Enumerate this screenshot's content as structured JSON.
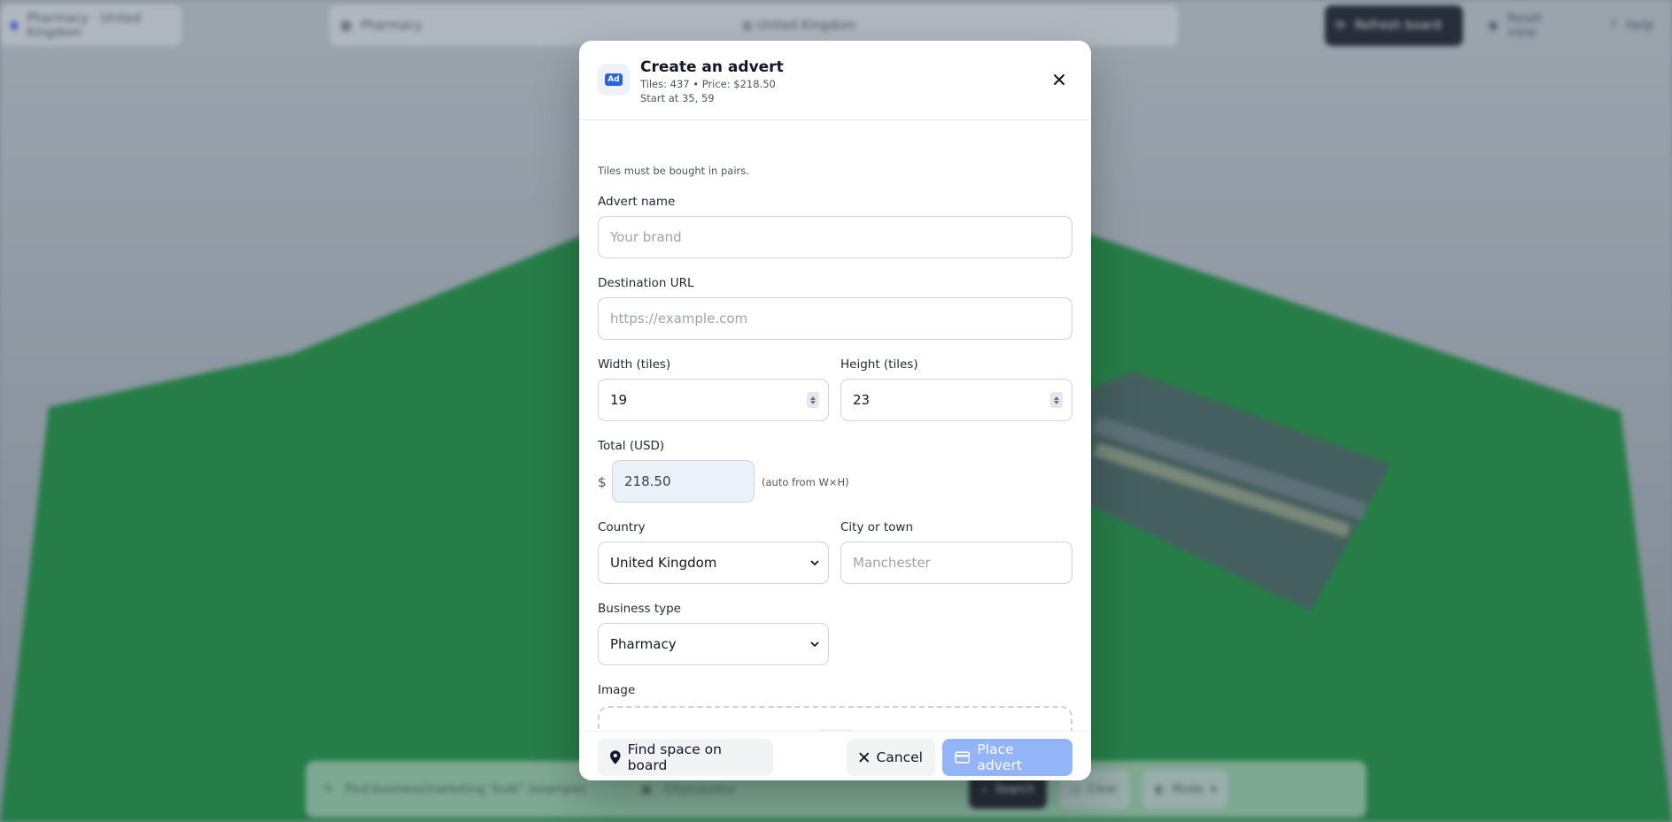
{
  "background": {
    "topbar": {
      "location_chip": "Pharmacy · United Kingdom",
      "search_category": "Pharmacy",
      "search_country": "United Kingdom",
      "refresh_label": "Refresh board",
      "reset_label": "Reset view",
      "help_label": "Help"
    },
    "bottombar": {
      "search_placeholder": "Find business/marketing \"bulk\" (example)",
      "location_placeholder": "City/country",
      "search_label": "Search",
      "clear_label": "Clear",
      "mode_label": "Mode"
    }
  },
  "modal": {
    "title": "Create an advert",
    "summary_line": "Tiles: 437 • Price: $218.50",
    "start_line": "Start at 35, 59",
    "badge_text": "Ad",
    "pairs_note": "Tiles must be bought in pairs.",
    "advert_name": {
      "label": "Advert name",
      "placeholder": "Your brand",
      "value": ""
    },
    "destination_url": {
      "label": "Destination URL",
      "placeholder": "https://example.com",
      "value": ""
    },
    "width": {
      "label": "Width (tiles)",
      "value": "19"
    },
    "height": {
      "label": "Height (tiles)",
      "value": "23"
    },
    "total": {
      "label": "Total (USD)",
      "currency": "$",
      "value": "218.50",
      "hint": "(auto from W×H)"
    },
    "country": {
      "label": "Country",
      "selected": "United Kingdom"
    },
    "city": {
      "label": "City or town",
      "placeholder": "Manchester",
      "value": ""
    },
    "business_type": {
      "label": "Business type",
      "selected": "Pharmacy"
    },
    "image": {
      "label": "Image"
    },
    "footer": {
      "find_space": "Find space on board",
      "cancel": "Cancel",
      "place": "Place advert"
    }
  },
  "colors": {
    "primary_disabled": "#93b4f7",
    "accent_blue": "#2563eb",
    "board_green": "#1f8a43"
  }
}
